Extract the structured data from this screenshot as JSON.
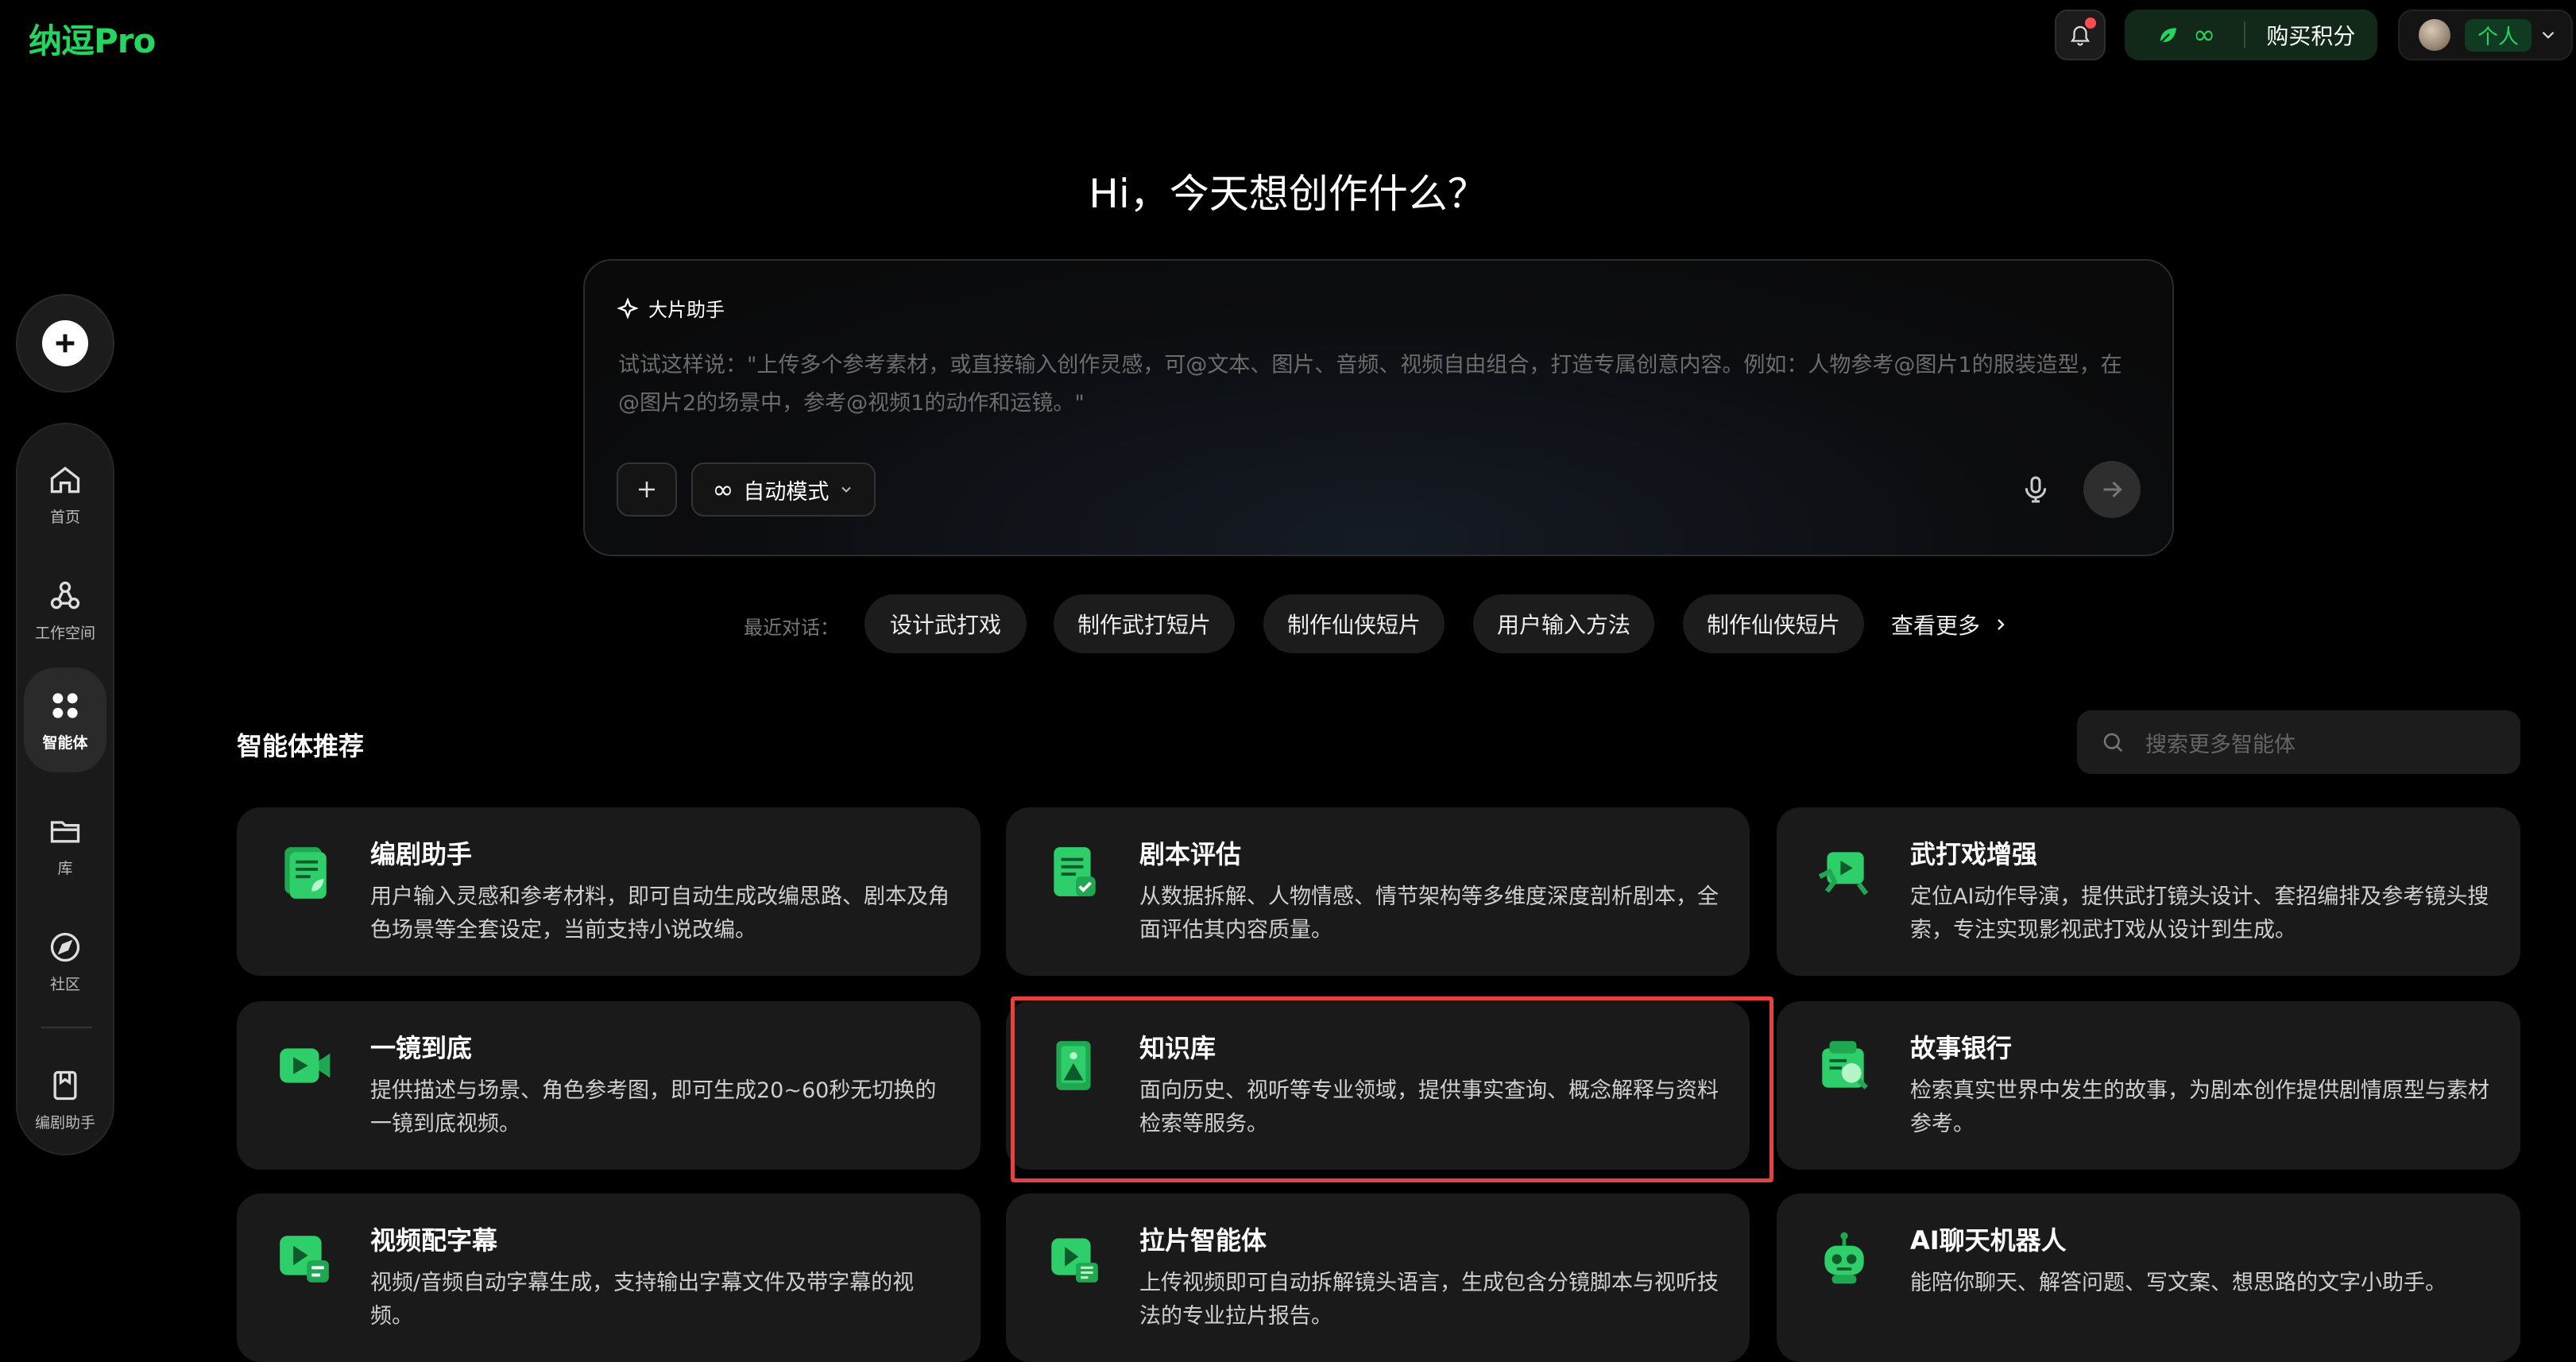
{
  "app": {
    "logo": "纳逗Pro"
  },
  "topbar": {
    "buy_points": "购买积分",
    "profile_tag": "个人"
  },
  "sidebar": {
    "items": [
      {
        "label": "首页",
        "icon": "home-icon"
      },
      {
        "label": "工作空间",
        "icon": "workspace-icon"
      },
      {
        "label": "智能体",
        "icon": "agents-icon",
        "active": true
      },
      {
        "label": "库",
        "icon": "folder-icon"
      },
      {
        "label": "社区",
        "icon": "compass-icon"
      },
      {
        "label": "编剧助手",
        "icon": "screenwriter-icon"
      }
    ]
  },
  "hero": {
    "headline": "Hi，今天想创作什么？",
    "assistant_label": "大片助手",
    "placeholder": "试试这样说：\"上传多个参考素材，或直接输入创作灵感，可@文本、图片、音频、视频自由组合，打造专属创意内容。例如：人物参考@图片1的服装造型，在@图片2的场景中，参考@视频1的动作和运镜。\"",
    "mode_label": "自动模式"
  },
  "recent": {
    "label": "最近对话：",
    "chips": [
      "设计武打戏",
      "制作武打短片",
      "制作仙侠短片",
      "用户输入方法",
      "制作仙侠短片"
    ],
    "more": "查看更多"
  },
  "agents": {
    "title": "智能体推荐",
    "search_placeholder": "搜索更多智能体",
    "cards": [
      {
        "title": "编剧助手",
        "desc": "用户输入灵感和参考材料，即可自动生成改编思路、剧本及角色场景等全套设定，当前支持小说改编。"
      },
      {
        "title": "剧本评估",
        "desc": "从数据拆解、人物情感、情节架构等多维度深度剖析剧本，全面评估其内容质量。"
      },
      {
        "title": "武打戏增强",
        "desc": "定位AI动作导演，提供武打镜头设计、套招编排及参考镜头搜索，专注实现影视武打戏从设计到生成。"
      },
      {
        "title": "一镜到底",
        "desc": "提供描述与场景、角色参考图，即可生成20~60秒无切换的一镜到底视频。"
      },
      {
        "title": "知识库",
        "desc": "面向历史、视听等专业领域，提供事实查询、概念解释与资料检索等服务。"
      },
      {
        "title": "故事银行",
        "desc": "检索真实世界中发生的故事，为剧本创作提供剧情原型与素材参考。"
      },
      {
        "title": "视频配字幕",
        "desc": "视频/音频自动字幕生成，支持输出字幕文件及带字幕的视频。"
      },
      {
        "title": "拉片智能体",
        "desc": "上传视频即可自动拆解镜头语言，生成包含分镜脚本与视听技法的专业拉片报告。"
      },
      {
        "title": "AI聊天机器人",
        "desc": "能陪你聊天、解答问题、写文案、想思路的文字小助手。"
      }
    ]
  },
  "colors": {
    "accent": "#22d660",
    "highlight": "#e8403e",
    "card_bg": "#1a1a1a"
  }
}
